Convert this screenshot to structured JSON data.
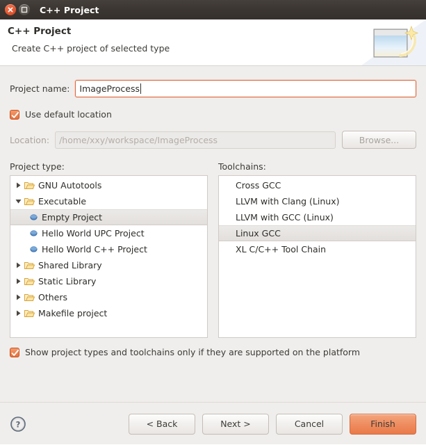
{
  "window": {
    "title": "C++ Project",
    "close_icon": "close-icon",
    "maximize_icon": "maximize-icon"
  },
  "header": {
    "title": "C++ Project",
    "subtitle": "Create C++ project of selected type",
    "banner_icon": "new-project-wizard-icon"
  },
  "form": {
    "project_name_label": "Project name:",
    "project_name_value": "ImageProcess",
    "use_default_location_label": "Use default location",
    "use_default_location_checked": true,
    "location_label": "Location:",
    "location_value": "/home/xxy/workspace/ImageProcess",
    "browse_label": "Browse...",
    "browse_enabled": false
  },
  "project_type": {
    "label": "Project type:",
    "items": [
      {
        "label": "GNU Autotools",
        "kind": "folder",
        "expanded": false,
        "depth": 0,
        "selected": false
      },
      {
        "label": "Executable",
        "kind": "folder",
        "expanded": true,
        "depth": 0,
        "selected": false
      },
      {
        "label": "Empty Project",
        "kind": "leaf",
        "depth": 1,
        "selected": true
      },
      {
        "label": "Hello World UPC Project",
        "kind": "leaf",
        "depth": 1,
        "selected": false
      },
      {
        "label": "Hello World C++ Project",
        "kind": "leaf",
        "depth": 1,
        "selected": false
      },
      {
        "label": "Shared Library",
        "kind": "folder",
        "expanded": false,
        "depth": 0,
        "selected": false
      },
      {
        "label": "Static Library",
        "kind": "folder",
        "expanded": false,
        "depth": 0,
        "selected": false
      },
      {
        "label": "Others",
        "kind": "folder",
        "expanded": false,
        "depth": 0,
        "selected": false
      },
      {
        "label": "Makefile project",
        "kind": "folder",
        "expanded": false,
        "depth": 0,
        "selected": false
      }
    ]
  },
  "toolchains": {
    "label": "Toolchains:",
    "items": [
      {
        "label": "Cross GCC",
        "selected": false
      },
      {
        "label": "LLVM with Clang (Linux)",
        "selected": false
      },
      {
        "label": "LLVM with GCC (Linux)",
        "selected": false
      },
      {
        "label": "Linux GCC",
        "selected": true
      },
      {
        "label": "XL C/C++ Tool Chain",
        "selected": false
      }
    ]
  },
  "show_supported": {
    "label": "Show project types and toolchains only if they are supported on the platform",
    "checked": true
  },
  "footer": {
    "help_icon": "help-icon",
    "back_label": "< Back",
    "next_label": "Next >",
    "cancel_label": "Cancel",
    "finish_label": "Finish"
  },
  "colors": {
    "accent": "#e8703c",
    "finish": "#ef8d60",
    "titlebar": "#3b3631",
    "dialog_bg": "#f0eeec"
  }
}
